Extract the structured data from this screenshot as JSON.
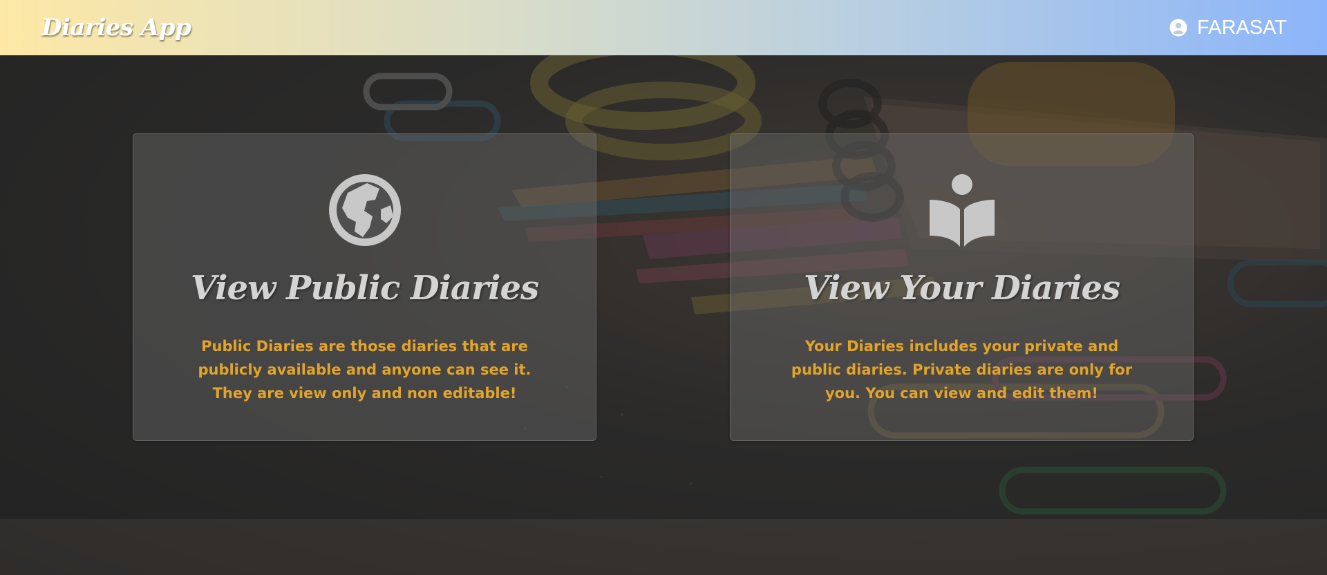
{
  "navbar": {
    "brand": "Diaries App",
    "username": "FARASAT",
    "user_icon": "user-circle-icon"
  },
  "cards": [
    {
      "icon": "globe-icon",
      "title": "View Public Diaries",
      "description": "Public Diaries are those diaries that are publicly available and anyone can see it. They are view only and non editable!"
    },
    {
      "icon": "book-reader-icon",
      "title": "View Your Diaries",
      "description": "Your Diaries includes your private and public diaries. Private diaries are only for you. You can view and edit them!"
    }
  ],
  "colors": {
    "navbar_gradient_start": "#fde8a6",
    "navbar_gradient_end": "#8cb5f9",
    "card_title": "#d4d4d4",
    "card_description": "#e3a42a",
    "icon": "#c8c8c8"
  }
}
